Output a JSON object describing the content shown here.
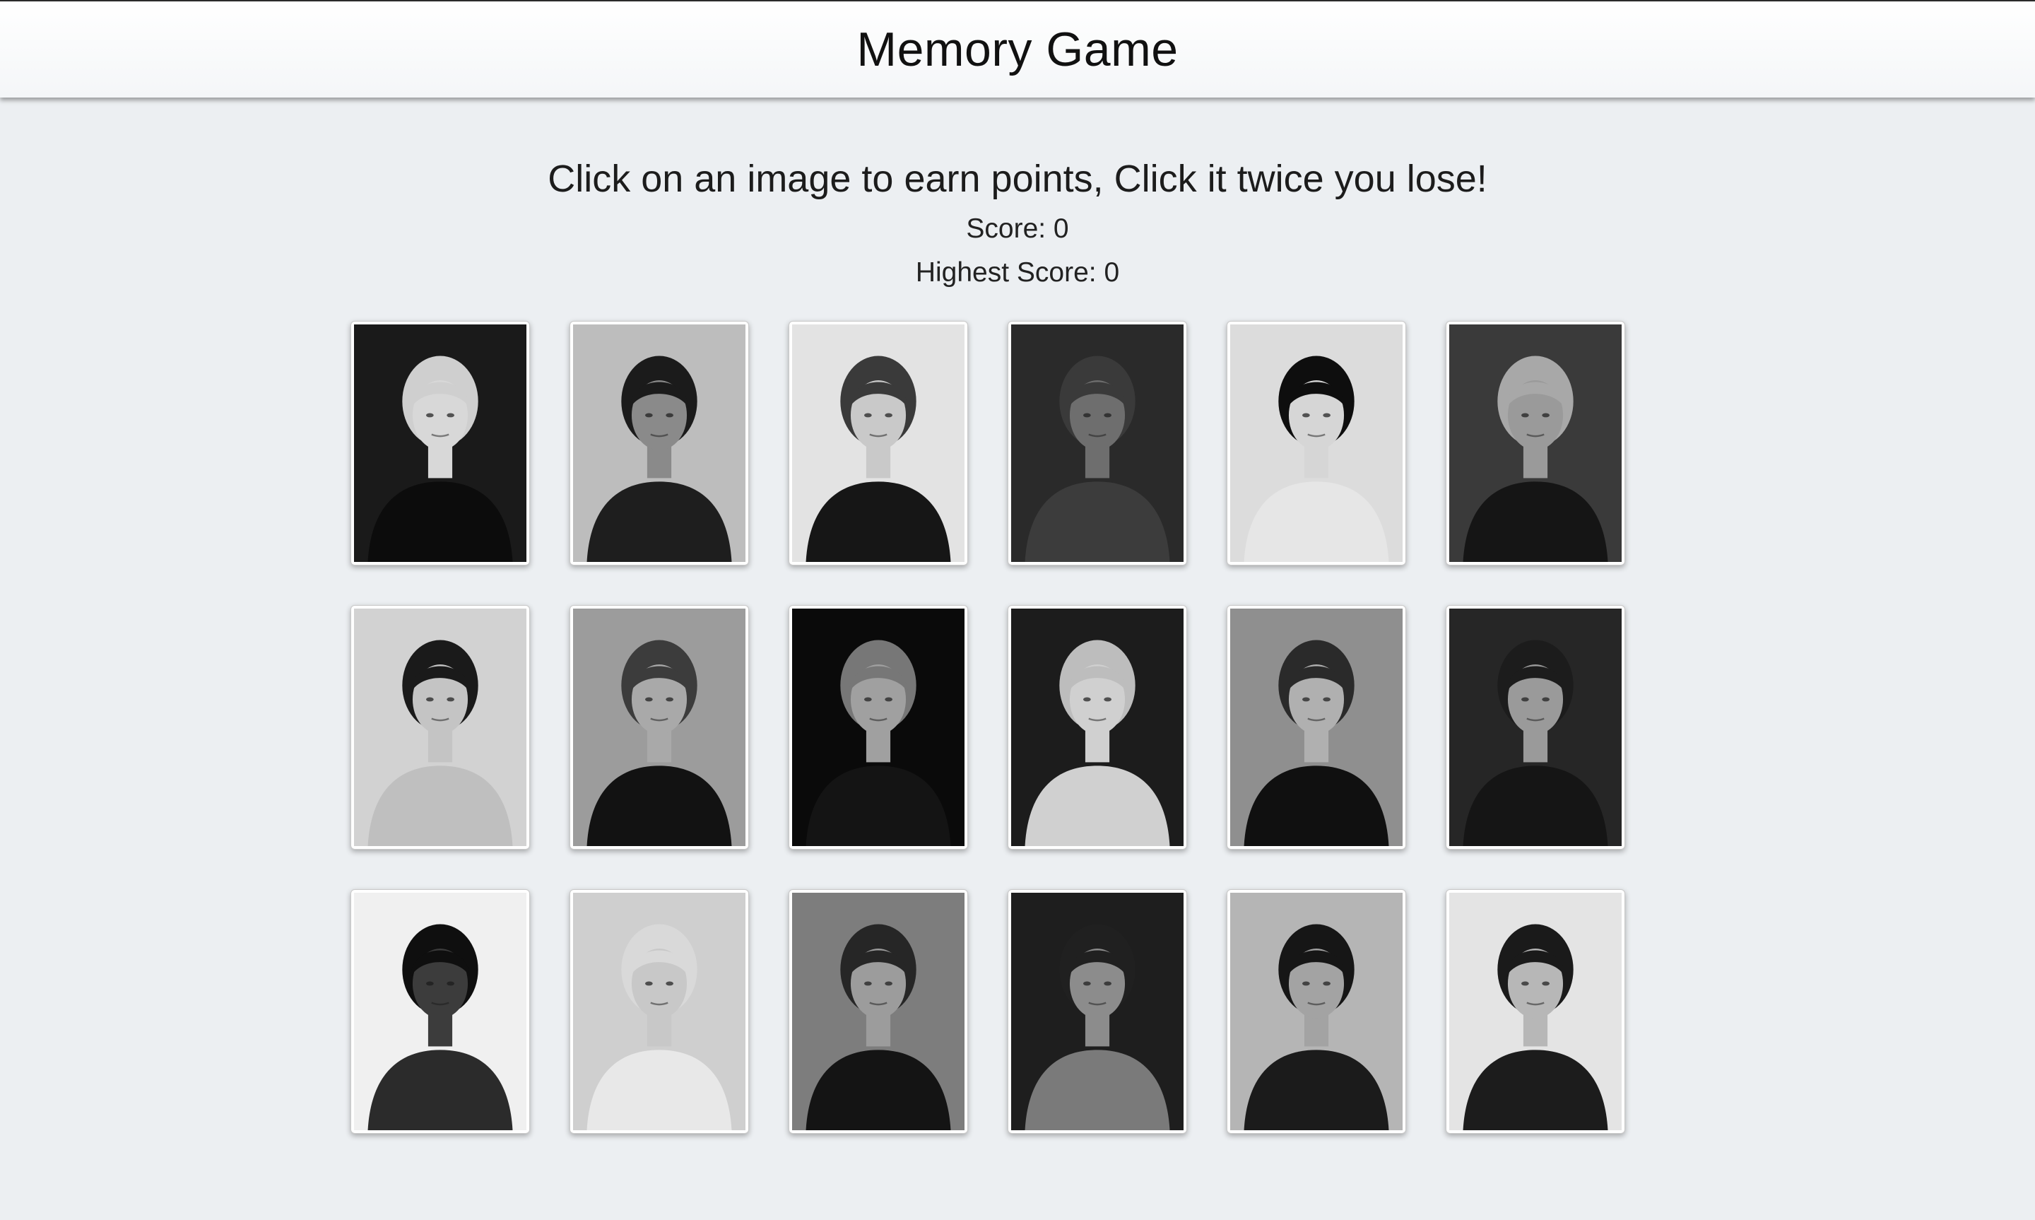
{
  "header": {
    "title": "Memory Game"
  },
  "game": {
    "instructions": "Click on an image to earn points, Click it twice you lose!",
    "score_text": "Score: 0",
    "highest_score_text": "Highest Score: 0",
    "score": 0,
    "highest_score": 0
  },
  "cards": [
    {
      "name": "woman-blonde-wavy-hair-portrait",
      "tone": "light",
      "bg": "#1a1a1a",
      "skin": "#d8d8d8",
      "hair": "#cfcfcf",
      "cloth": "#0c0c0c"
    },
    {
      "name": "man-leaning-pool-table-portrait",
      "tone": "mid",
      "bg": "#bdbdbd",
      "skin": "#8a8a8a",
      "hair": "#1b1b1b",
      "cloth": "#1e1e1e"
    },
    {
      "name": "woman-short-hair-seated-portrait",
      "tone": "light",
      "bg": "#e3e3e3",
      "skin": "#c9c9c9",
      "hair": "#3a3a3a",
      "cloth": "#161616"
    },
    {
      "name": "man-dark-jacket-portrait",
      "tone": "dark",
      "bg": "#2a2a2a",
      "skin": "#6e6e6e",
      "hair": "#3a3a3a",
      "cloth": "#3c3c3c"
    },
    {
      "name": "woman-hat-pearl-necklace-portrait",
      "tone": "light",
      "bg": "#dcdcdc",
      "skin": "#d6d6d6",
      "hair": "#0e0e0e",
      "cloth": "#e6e6e6"
    },
    {
      "name": "man-hand-on-chin-portrait",
      "tone": "dark",
      "bg": "#3a3a3a",
      "skin": "#9a9a9a",
      "hair": "#a8a8a8",
      "cloth": "#151515"
    },
    {
      "name": "woman-long-dark-hair-portrait",
      "tone": "light",
      "bg": "#d2d2d2",
      "skin": "#c4c4c4",
      "hair": "#1a1a1a",
      "cloth": "#bfbfbf"
    },
    {
      "name": "man-beard-hand-on-face-portrait",
      "tone": "mid",
      "bg": "#9c9c9c",
      "skin": "#a9a9a9",
      "hair": "#3c3c3c",
      "cloth": "#121212"
    },
    {
      "name": "man-suit-seated-dark-portrait",
      "tone": "dark",
      "bg": "#0a0a0a",
      "skin": "#a0a0a0",
      "hair": "#777777",
      "cloth": "#141414"
    },
    {
      "name": "woman-long-light-hair-portrait",
      "tone": "mid",
      "bg": "#1c1c1c",
      "skin": "#d0d0d0",
      "hair": "#bdbdbd",
      "cloth": "#d0d0d0"
    },
    {
      "name": "man-tuxedo-holding-glass-portrait",
      "tone": "mid",
      "bg": "#8f8f8f",
      "skin": "#b0b0b0",
      "hair": "#2a2a2a",
      "cloth": "#101010"
    },
    {
      "name": "man-sweater-close-up-portrait",
      "tone": "dark",
      "bg": "#262626",
      "skin": "#9a9a9a",
      "hair": "#1c1c1c",
      "cloth": "#151515"
    },
    {
      "name": "man-head-bowed-portrait",
      "tone": "light",
      "bg": "#f0f0f0",
      "skin": "#3c3c3c",
      "hair": "#0f0f0f",
      "cloth": "#2b2b2b"
    },
    {
      "name": "woman-short-blonde-hair-portrait",
      "tone": "light",
      "bg": "#cfcfcf",
      "skin": "#c8c8c8",
      "hair": "#d9d9d9",
      "cloth": "#e8e8e8"
    },
    {
      "name": "man-sunglasses-suit-portrait",
      "tone": "mid",
      "bg": "#7d7d7d",
      "skin": "#9c9c9c",
      "hair": "#262626",
      "cloth": "#141414"
    },
    {
      "name": "man-shirtless-sideburns-portrait",
      "tone": "dark",
      "bg": "#1e1e1e",
      "skin": "#8c8c8c",
      "hair": "#202020",
      "cloth": "#7a7a7a"
    },
    {
      "name": "man-playing-guitar-portrait",
      "tone": "mid",
      "bg": "#b5b5b5",
      "skin": "#a3a3a3",
      "hair": "#161616",
      "cloth": "#1b1b1b"
    },
    {
      "name": "man-hands-clasped-collar-portrait",
      "tone": "light",
      "bg": "#e4e4e4",
      "skin": "#b7b7b7",
      "hair": "#1a1a1a",
      "cloth": "#1c1c1c"
    }
  ]
}
